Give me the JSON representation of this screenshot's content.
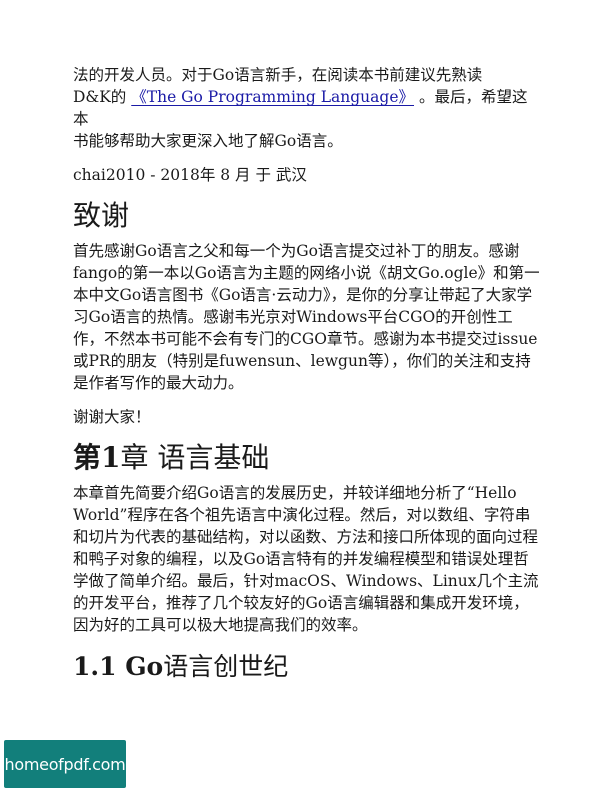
{
  "intro": {
    "line1": "法的开发人员。对于Go语言新手，在阅读本书前建议先熟读",
    "line2_prefix": "D&K的",
    "book_link": "《The Go Programming Language》",
    "line2_suffix": "。最后，希望这本",
    "line3": "书能够帮助大家更深入地了解Go语言。"
  },
  "signature": "chai2010 - 2018年 8 月 于 武汉",
  "acknowledgements": {
    "heading": "致谢",
    "body": "首先感谢Go语言之父和每一个为Go语言提交过补丁的朋友。感谢fango的第一本以Go语言为主题的网络小说《胡文Go.ogle》和第一本中文Go语言图书《Go语言·云动力》，是你的分享让带起了大家学习Go语言的热情。感谢韦光京对Windows平台CGO的开创性工作，不然本书可能不会有专门的CGO章节。感谢为本书提交过issue或PR的朋友（特别是fuwensun、lewgun等），你们的关注和支持是作者写作的最大动力。",
    "thanks": "谢谢大家！"
  },
  "chapter1": {
    "number": "第1",
    "title": "章 语言基础",
    "body": "本章首先简要介绍Go语言的发展历史，并较详细地分析了“Hello World”程序在各个祖先语言中演化过程。然后，对以数组、字符串和切片为代表的基础结构，对以函数、方法和接口所体现的面向过程和鸭子对象的编程，以及Go语言特有的并发编程模型和错误处理哲学做了简单介绍。最后，针对macOS、Windows、Linux几个主流的开发平台，推荐了几个较友好的Go语言编辑器和集成开发环境，因为好的工具可以极大地提高我们的效率。"
  },
  "section1_1": {
    "number": "1.1 Go",
    "title": "语言创世纪"
  },
  "watermark": {
    "text": "homeofpdf.com",
    "color": "#127f7b"
  }
}
